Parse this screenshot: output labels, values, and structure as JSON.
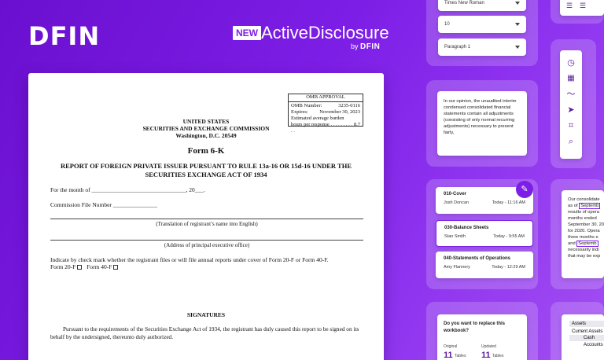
{
  "brand": {
    "logo": "DFIN",
    "badge": "NEW",
    "product": "ActiveDisclosure",
    "by": "by",
    "by_logo": "DFIN"
  },
  "document": {
    "omb": {
      "title": "OMB APPROVAL",
      "number_label": "OMB Number:",
      "number": "3235-0116",
      "expires_label": "Expires:",
      "expires": "November 30, 2023",
      "burden_label": "Estimated average burden",
      "hours_label": "hours per response . . . . . . . . . . .",
      "hours": "8.7"
    },
    "header": [
      "UNITED STATES",
      "SECURITIES AND EXCHANGE COMMISSION",
      "Washington, D.C. 20549"
    ],
    "form_title": "Form 6-K",
    "report_title": "REPORT OF FOREIGN PRIVATE ISSUER PURSUANT TO RULE 13a-16 OR 15d-16 UNDER THE SECURITIES EXCHANGE ACT OF 1934",
    "month_line": "For the month of ________________________________, 20___.",
    "file_line": "Commission File Number _______________",
    "caption_name": "(Translation of registrant’s name into English)",
    "caption_address": "(Address of principal executive office)",
    "indicate_line": "Indicate by check mark whether the registrant files or will file annual reports under cover of Form 20-F or Form 40-F.",
    "form20f": "Form 20-F",
    "form40f": "Form 40-F",
    "signatures": "SIGNATURES",
    "sig_text": "Pursuant to the requirements of the Securities Exchange Act of 1934, the registrant has duly caused this report to be signed on its behalf by the undersigned, thereunto duly authorized."
  },
  "format_panel": {
    "font": "Times New Roman",
    "size": "10",
    "style": "Paragraph 1"
  },
  "tools": [
    "clock-icon",
    "calendar-icon",
    "trend-icon",
    "send-icon",
    "crop-icon",
    "search-icon"
  ],
  "comment": {
    "text": "In our opinion, the unaudited interim condensed consolidated financial statements contain all adjustments (consisting of only normal recurring adjustments) necessary to present fairly,"
  },
  "history": [
    {
      "title": "010-Cover",
      "user": "Josh Doncan",
      "time": "Today - 11:16 AM"
    },
    {
      "title": "030-Balance Sheets",
      "user": "Stan Smith",
      "time": "Today - 9:55 AM"
    },
    {
      "title": "040-Statements of Operations",
      "user": "Amy Flannery",
      "time": "Today - 12:29 AM"
    }
  ],
  "replace": {
    "question": "Do you want to replace this workbook?",
    "original_label": "Original",
    "updated_label": "Updated",
    "original_count": "11",
    "updated_count": "11",
    "tables_label": "Tables"
  },
  "partial_text": {
    "lines": [
      "Our consolidate",
      "as of",
      "results of opera",
      "months ended",
      "September 30, 20",
      "for 2020. Opera",
      "three months e",
      "and",
      "necessarily indi",
      "that may be exp"
    ],
    "sept": "Septemb"
  },
  "assets": {
    "title": "Assets",
    "current": "Current Assets",
    "cash": "Cash",
    "accounts": "Accounts"
  }
}
